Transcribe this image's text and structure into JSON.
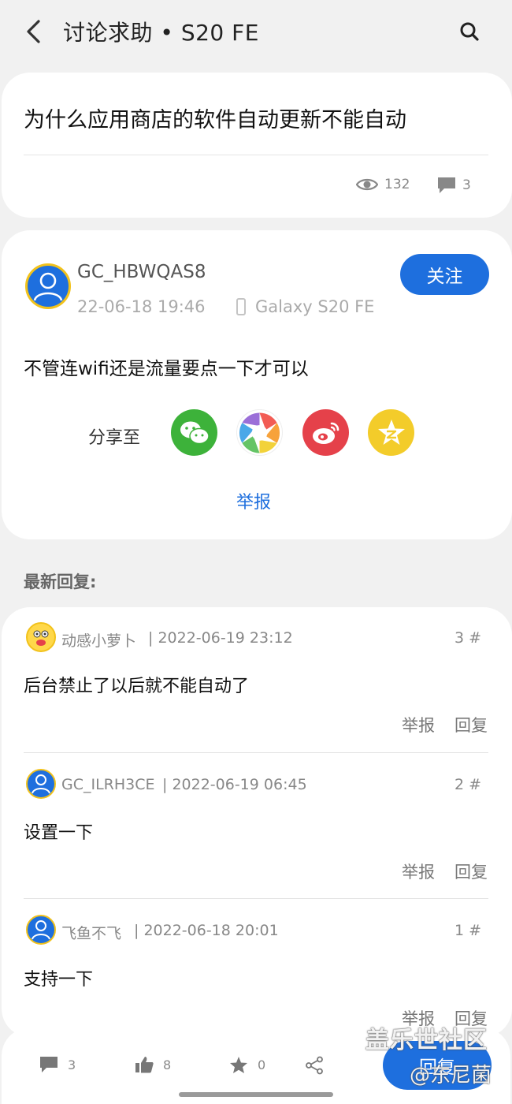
{
  "header": {
    "title": "讨论求助 • S20 FE",
    "back_icon": "chevron-left-icon",
    "search_icon": "search-icon"
  },
  "post": {
    "title": "为什么应用商店的软件自动更新不能自动",
    "views": "132",
    "comments": "3",
    "author": "GC_HBWQAS8",
    "time": "22-06-18 19:46",
    "device": "Galaxy S20 FE",
    "follow_label": "关注",
    "body": "不管连wifi还是流量要点一下才可以",
    "share_label": "分享至",
    "share_targets": [
      "wechat-icon",
      "moments-icon",
      "weibo-icon",
      "qzone-icon"
    ],
    "report_label": "举报"
  },
  "replies_label": "最新回复:",
  "replies": [
    {
      "name": "动感小萝卜",
      "date": "| 2022-06-19 23:12",
      "floor": "3 #",
      "text": "后台禁止了以后就不能自动了",
      "report": "举报",
      "reply": "回复"
    },
    {
      "name": "GC_ILRH3CE",
      "date": "| 2022-06-19 06:45",
      "floor": "2 #",
      "text": "设置一下",
      "report": "举报",
      "reply": "回复"
    },
    {
      "name": "飞鱼不飞",
      "date": "| 2022-06-18 20:01",
      "floor": "1 #",
      "text": "支持一下",
      "report": "举报",
      "reply": "回复"
    }
  ],
  "bottom_bar": {
    "comments": "3",
    "likes": "8",
    "favorites": "0",
    "reply_label": "回复"
  },
  "watermark": {
    "line1": "盖乐世社区",
    "line2": "@东尼菌"
  },
  "colors": {
    "accent": "#1e6fde",
    "background": "#f1f1f1",
    "card": "#ffffff",
    "avatar_ring": "#f2c21b"
  }
}
